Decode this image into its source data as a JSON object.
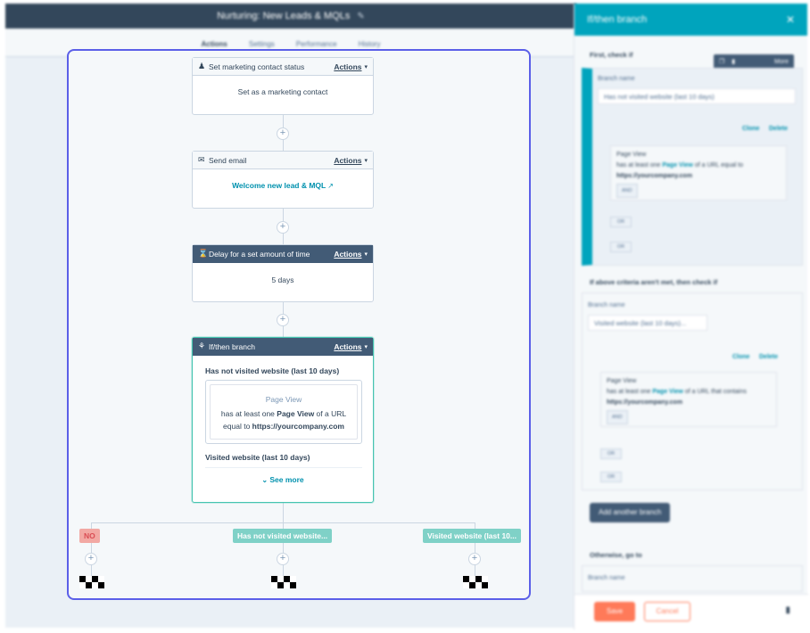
{
  "background": {
    "title": "Nurturing: New Leads & MQLs",
    "edit_icon": "pencil-icon",
    "tabs": [
      {
        "label": "Actions",
        "active": true
      },
      {
        "label": "Settings",
        "active": false
      },
      {
        "label": "Performance",
        "active": false
      },
      {
        "label": "History",
        "active": false
      }
    ]
  },
  "workflow": {
    "add_glyph": "+",
    "actions_label": "Actions",
    "caret": "▾",
    "cards": [
      {
        "icon": "contact-icon",
        "title": "Set marketing contact status",
        "body": "Set as a marketing contact"
      },
      {
        "icon": "envelope-icon",
        "title": "Send email",
        "body_link": "Welcome new lead & MQL",
        "link_icon": "external-link-icon"
      },
      {
        "icon": "hourglass-icon",
        "title": "Delay for a set amount of time",
        "body": "5 days"
      }
    ],
    "branch": {
      "icon": "branch-icon",
      "title": "If/then branch",
      "branch1_name": "Has not visited website (last 10 days)",
      "filter_type": "Page View",
      "filter_line1_pre": "has at least one ",
      "filter_line1_bold": "Page View",
      "filter_line1_post": " of a URL",
      "filter_line2_pre": "equal to ",
      "filter_line2_bold": "https://yourcompany.com",
      "branch2_name": "Visited website (last 10 days)",
      "see_more": "See more",
      "see_more_icon": "chevron-down-icon"
    },
    "outcomes": [
      {
        "label": "NO",
        "style": "no"
      },
      {
        "label": "Has not visited website...",
        "style": "teal"
      },
      {
        "label": "Visited website (last 10...",
        "style": "teal"
      }
    ]
  },
  "panel": {
    "title": "If/then branch",
    "close_icon": "close-icon",
    "toolbar_more": "More",
    "section1": "First, check if",
    "branch_name_label": "Branch name",
    "branch1_input": "Has not visited website (last 10 days)",
    "clone": "Clone",
    "delete": "Delete",
    "filter1_type": "Page View",
    "filter1_text_pre": "has at least one ",
    "filter1_text_link": "Page View",
    "filter1_text_post": " of a URL equal to",
    "filter1_url": "https://yourcompany.com",
    "chip_and": "AND",
    "chip_or": "OR",
    "section2": "If above criteria aren't met, then check if",
    "branch2_input": "Visited website (last 10 days)...",
    "filter2_text_post": " of a URL that contains",
    "add_branch": "Add another branch",
    "section3": "Otherwise, go to",
    "save": "Save",
    "cancel": "Cancel",
    "trash_icon": "trash-icon"
  }
}
